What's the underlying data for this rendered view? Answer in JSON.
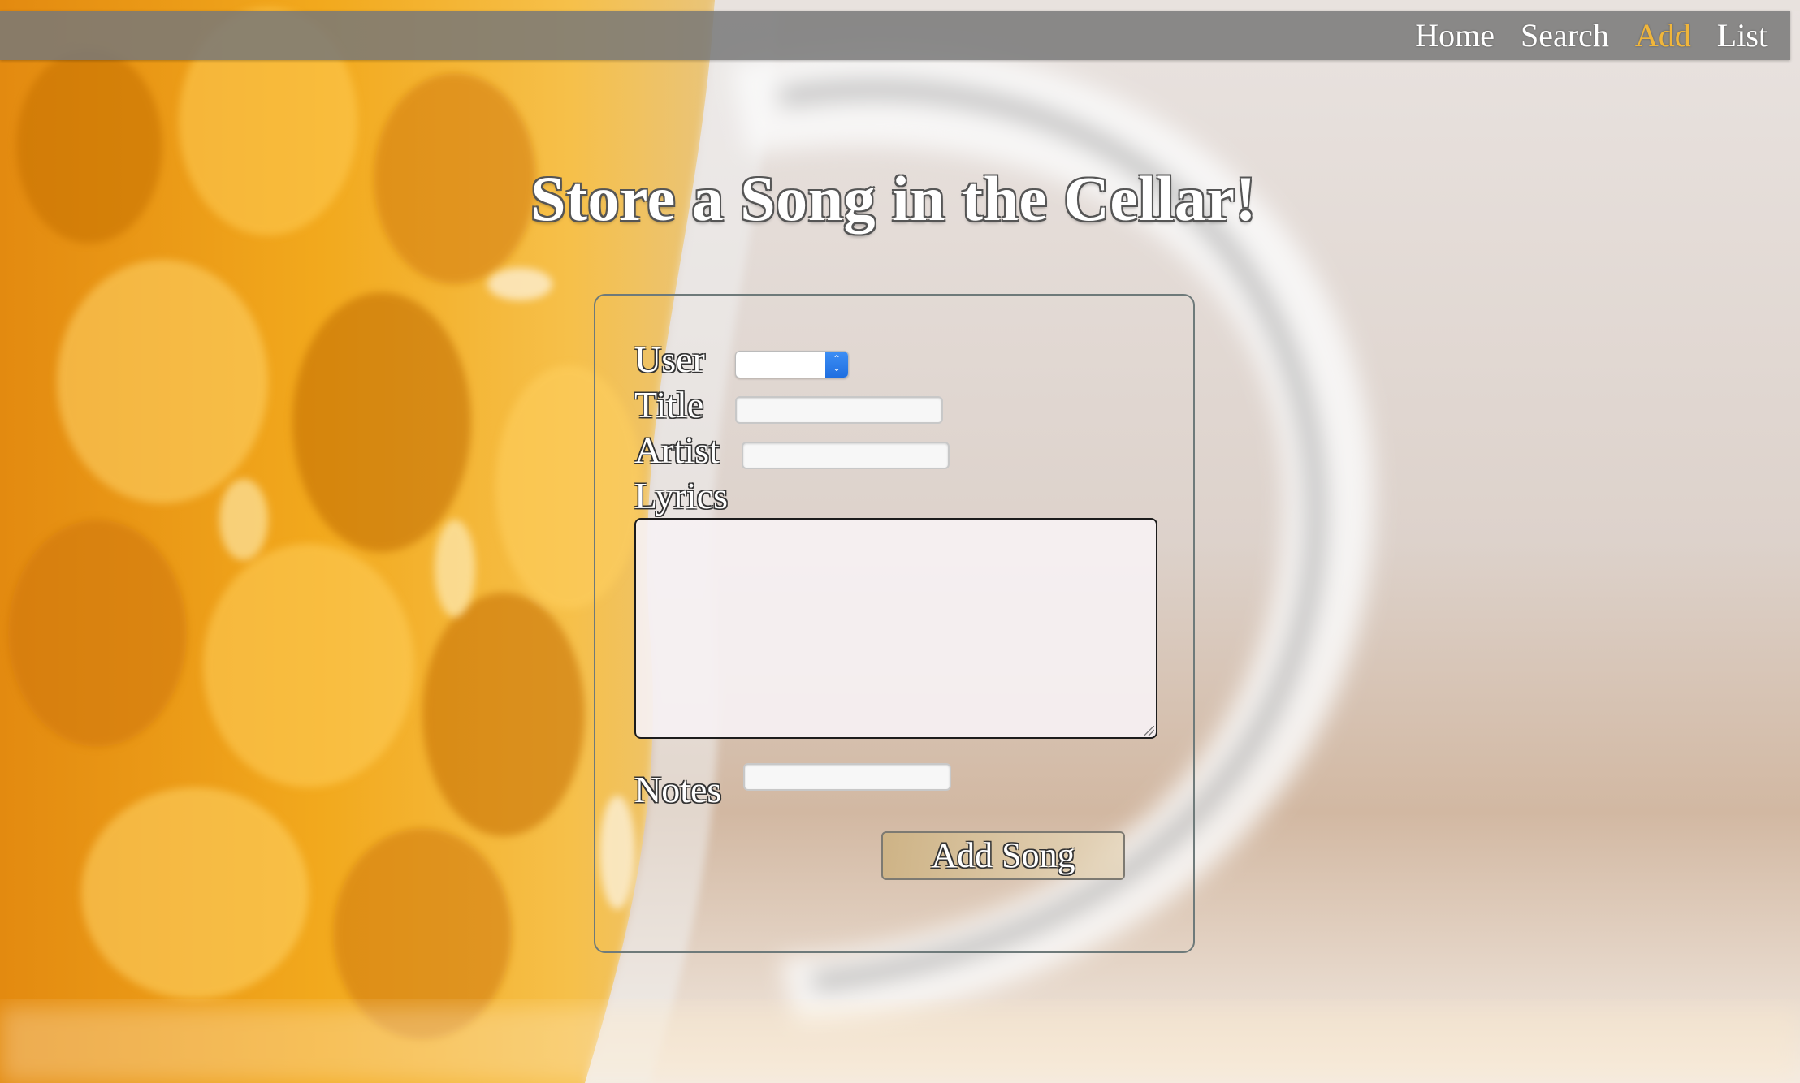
{
  "nav": {
    "items": [
      {
        "label": "Home",
        "active": false
      },
      {
        "label": "Search",
        "active": false
      },
      {
        "label": "Add",
        "active": true
      },
      {
        "label": "List",
        "active": false
      }
    ],
    "active_color": "#f1b63a"
  },
  "page": {
    "title": "Store a Song in the Cellar!"
  },
  "form": {
    "user_label": "User",
    "user_value": "",
    "title_label": "Title",
    "title_value": "",
    "artist_label": "Artist",
    "artist_value": "",
    "lyrics_label": "Lyrics",
    "lyrics_value": "",
    "notes_label": "Notes",
    "notes_value": "",
    "submit_label": "Add Song"
  },
  "icons": {
    "select_arrows": "chevron-updown-icon",
    "resize_grip": "resize-grip-icon"
  },
  "colors": {
    "beer_amber": "#f0a020",
    "navbar": "#7a7a7a",
    "select_accent": "#2b7de9"
  }
}
